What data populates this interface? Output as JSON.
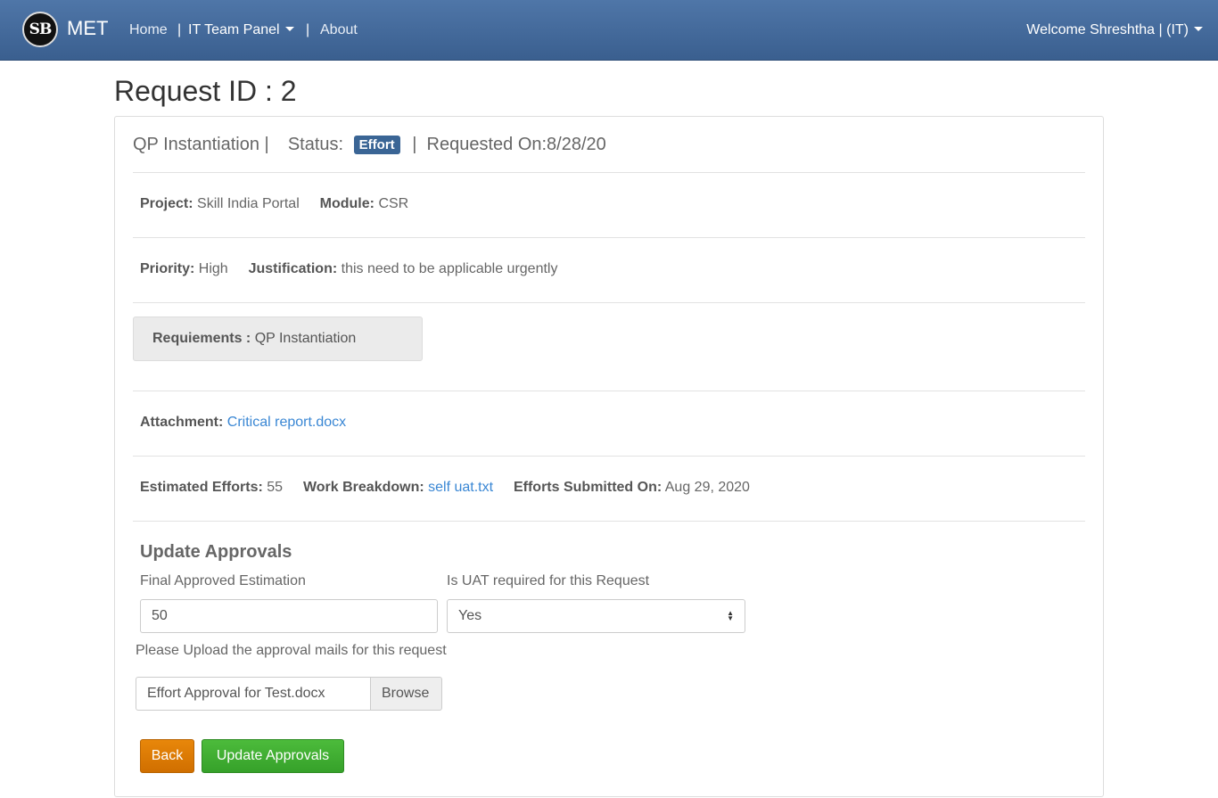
{
  "navbar": {
    "logo_text": "SB",
    "brand": "MET",
    "home": "Home",
    "sep1": "|",
    "it_panel": "IT Team Panel",
    "sep2": "|",
    "about": "About",
    "user": "Welcome Shreshtha | (IT)"
  },
  "page": {
    "title": "Request ID : 2"
  },
  "header": {
    "request_name": "QP Instantiation |",
    "status_label": "Status:",
    "status_value": "Effort",
    "requested_on": "|  Requested On:8/28/20"
  },
  "details": {
    "project_label": "Project:",
    "project_value": "Skill India Portal",
    "module_label": "Module:",
    "module_value": "CSR",
    "priority_label": "Priority:",
    "priority_value": "High",
    "justification_label": "Justification:",
    "justification_value": "this need to be applicable urgently",
    "requirements_label": "Requiements :",
    "requirements_value": "QP Instantiation",
    "attachment_label": "Attachment:",
    "attachment_link": "Critical report.docx",
    "estimated_label": "Estimated Efforts:",
    "estimated_value": "55",
    "breakdown_label": "Work Breakdown:",
    "breakdown_link": "self uat.txt",
    "submitted_label": "Efforts Submitted On:",
    "submitted_value": "Aug 29, 2020"
  },
  "form": {
    "section_title": "Update Approvals",
    "estimation_label": "Final Approved Estimation",
    "estimation_value": "50",
    "uat_label": "Is UAT required for this Request",
    "uat_value": "Yes",
    "upload_label": "Please Upload the approval mails for this request",
    "file_name": "Effort Approval for Test.docx",
    "browse_label": "Browse",
    "back_label": "Back",
    "update_label": "Update Approvals"
  }
}
